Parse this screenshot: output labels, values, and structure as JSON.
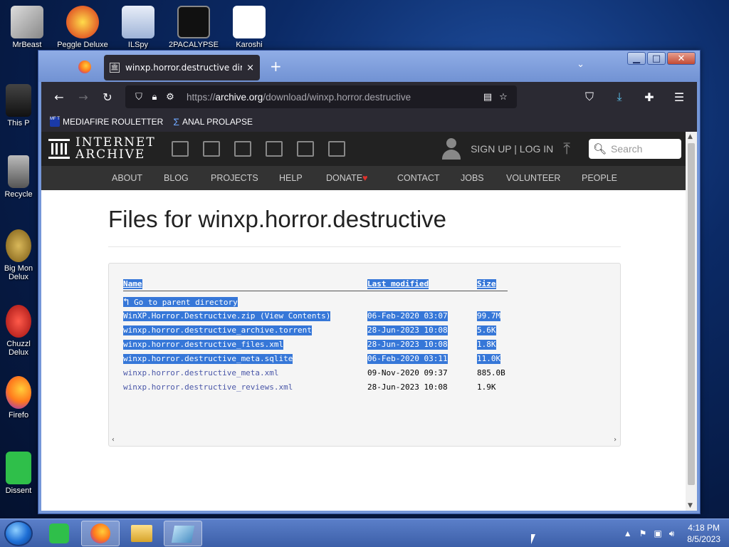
{
  "desktop": {
    "icons": [
      {
        "label": "MrBeast"
      },
      {
        "label": "Peggle Deluxe"
      },
      {
        "label": "ILSpy"
      },
      {
        "label": "2PACALYPSE"
      },
      {
        "label": "Karoshi"
      },
      {
        "label": "This P"
      },
      {
        "label": "Recycle"
      },
      {
        "label": "Big Mon Delux"
      },
      {
        "label": "Chuzzl Delux"
      },
      {
        "label": "Firefo"
      },
      {
        "label": "Dissent"
      }
    ]
  },
  "browser": {
    "tab": {
      "title": "winxp.horror.destructive directory",
      "close": "×",
      "favicon": "🏛"
    },
    "new_tab": "+",
    "list_tabs": "⌄",
    "window_controls": {
      "minimize": "▁",
      "maximize": "□",
      "close": "✕"
    },
    "nav": {
      "back": "←",
      "forward": "→",
      "reload": "↻"
    },
    "url": {
      "prefix": "https://",
      "host": "archive.org",
      "path": "/download/winxp.horror.destructive"
    },
    "bookmarks": [
      {
        "label": "MEDIAFIRE ROULETTER",
        "icon_text": "MF T"
      },
      {
        "label": "ANAL PROLAPSE",
        "icon": "Σ"
      }
    ]
  },
  "ia": {
    "logo_line1": "INTERNET",
    "logo_line2": "ARCHIVE",
    "signup": "SIGN UP | LOG IN",
    "search_placeholder": "Search",
    "menu": [
      "ABOUT",
      "BLOG",
      "PROJECTS",
      "HELP",
      "DONATE",
      "CONTACT",
      "JOBS",
      "VOLUNTEER",
      "PEOPLE"
    ],
    "donate_heart": "♥"
  },
  "page": {
    "title": "Files for winxp.horror.destructive",
    "columns": {
      "name": "Name",
      "modified": "Last modified",
      "size": "Size"
    },
    "parent": "Go to parent directory",
    "parent_icon": "↰",
    "files": [
      {
        "name": "WinXP.Horror.Destructive.zip (View Contents)",
        "modified": "06-Feb-2020 03:07",
        "size": "99.7M"
      },
      {
        "name": "winxp.horror.destructive_archive.torrent",
        "modified": "28-Jun-2023 10:08",
        "size": "5.6K"
      },
      {
        "name": "winxp.horror.destructive_files.xml",
        "modified": "28-Jun-2023 10:08",
        "size": "1.8K"
      },
      {
        "name": "winxp.horror.destructive_meta.sqlite",
        "modified": "06-Feb-2020 03:11",
        "size": "11.0K"
      },
      {
        "name": "winxp.horror.destructive_meta.xml",
        "modified": "09-Nov-2020 09:37",
        "size": "885.0B"
      },
      {
        "name": "winxp.horror.destructive_reviews.xml",
        "modified": "28-Jun-2023 10:08",
        "size": "1.9K"
      }
    ]
  },
  "taskbar": {
    "time": "4:18 PM",
    "date": "8/5/2023"
  }
}
